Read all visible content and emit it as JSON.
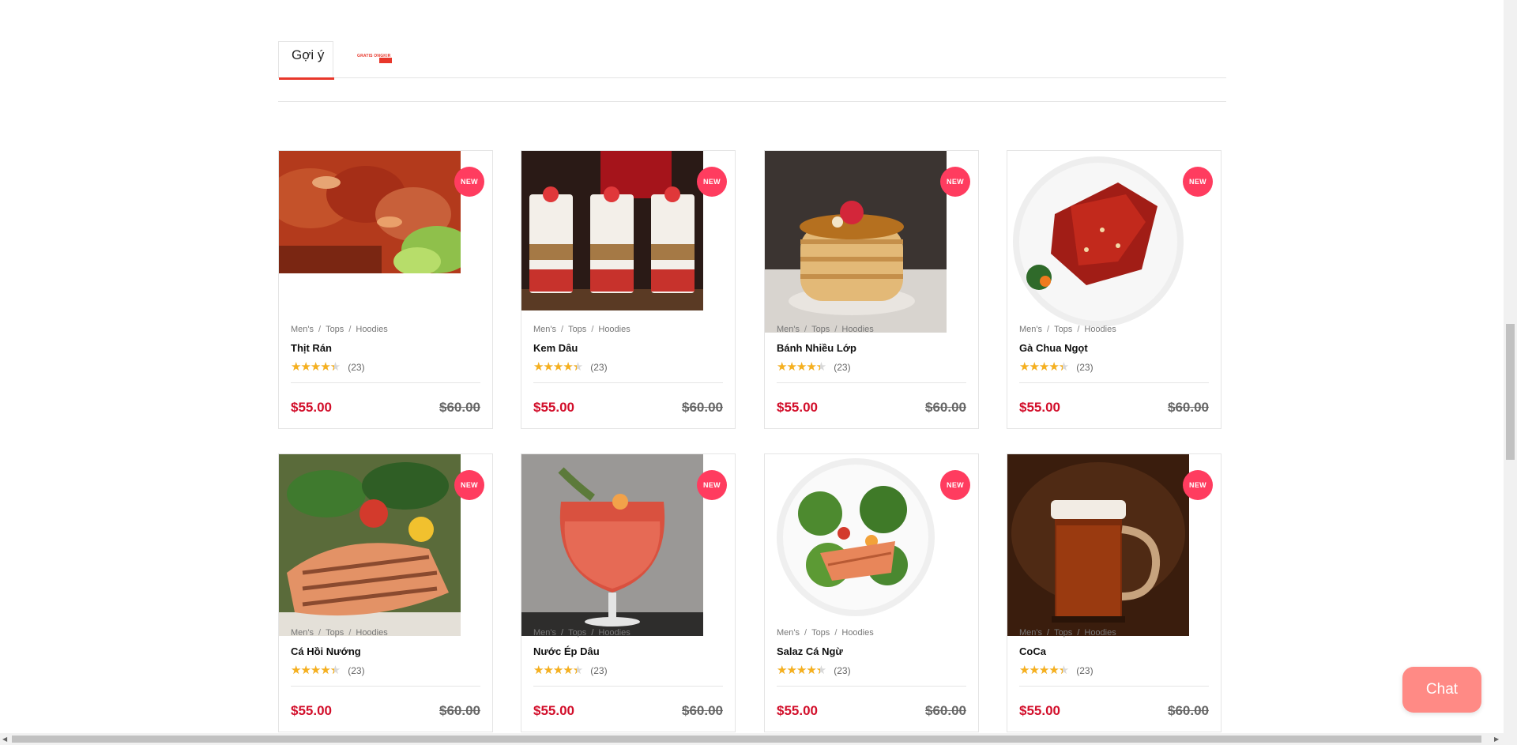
{
  "tabs": {
    "active_label": "Gợi ý",
    "promo_text": "GRATIS ONGKIR"
  },
  "colors": {
    "accent": "#e8372b",
    "badge": "#ff3c5f",
    "price": "#d20e2a",
    "star": "#f6b01e",
    "chat": "#ff8a85"
  },
  "products": [
    {
      "badge": "NEW",
      "crumbs": [
        "Men's",
        "Tops",
        "Hoodies"
      ],
      "name": "Thịt Rán",
      "rating": 4.5,
      "reviews": "(23)",
      "price": "$55.00",
      "old_price": "$60.00",
      "image": "grilled-pork"
    },
    {
      "badge": "NEW",
      "crumbs": [
        "Men's",
        "Tops",
        "Hoodies"
      ],
      "name": "Kem Dâu",
      "rating": 4.5,
      "reviews": "(23)",
      "price": "$55.00",
      "old_price": "$60.00",
      "image": "strawberry-parfait"
    },
    {
      "badge": "NEW",
      "crumbs": [
        "Men's",
        "Tops",
        "Hoodies"
      ],
      "name": "Bánh Nhiều Lớp",
      "rating": 4.5,
      "reviews": "(23)",
      "price": "$55.00",
      "old_price": "$60.00",
      "image": "pancake-stack"
    },
    {
      "badge": "NEW",
      "crumbs": [
        "Men's",
        "Tops",
        "Hoodies"
      ],
      "name": "Gà Chua Ngọt",
      "rating": 4.5,
      "reviews": "(23)",
      "price": "$55.00",
      "old_price": "$60.00",
      "image": "sweet-sour-chicken"
    },
    {
      "badge": "NEW",
      "crumbs": [
        "Men's",
        "Tops",
        "Hoodies"
      ],
      "name": "Cá Hồi Nướng",
      "rating": 4.5,
      "reviews": "(23)",
      "price": "$55.00",
      "old_price": "$60.00",
      "image": "grilled-salmon"
    },
    {
      "badge": "NEW",
      "crumbs": [
        "Men's",
        "Tops",
        "Hoodies"
      ],
      "name": "Nước Ép Dâu",
      "rating": 4.5,
      "reviews": "(23)",
      "price": "$55.00",
      "old_price": "$60.00",
      "image": "strawberry-drink"
    },
    {
      "badge": "NEW",
      "crumbs": [
        "Men's",
        "Tops",
        "Hoodies"
      ],
      "name": "Salaz Cá Ngừ",
      "rating": 4.5,
      "reviews": "(23)",
      "price": "$55.00",
      "old_price": "$60.00",
      "image": "fish-salad"
    },
    {
      "badge": "NEW",
      "crumbs": [
        "Men's",
        "Tops",
        "Hoodies"
      ],
      "name": "CoCa",
      "rating": 4.5,
      "reviews": "(23)",
      "price": "$55.00",
      "old_price": "$60.00",
      "image": "cola-mug"
    }
  ],
  "chat": {
    "label": "Chat"
  }
}
